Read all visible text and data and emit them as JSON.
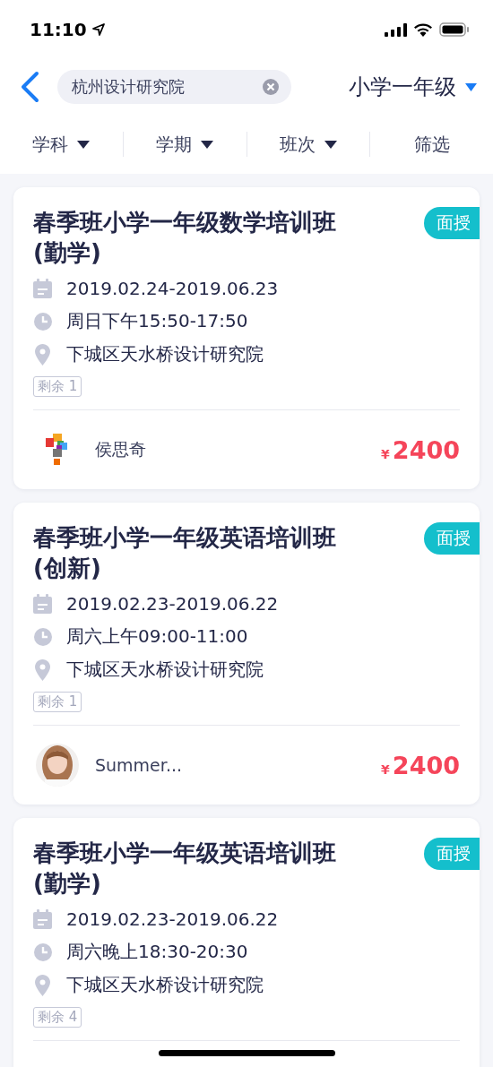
{
  "status_bar": {
    "time": "11:10"
  },
  "search": {
    "value": "杭州设计研究院"
  },
  "grade": {
    "label": "小学一年级"
  },
  "filters": [
    {
      "label": "学科",
      "dropdown": true
    },
    {
      "label": "学期",
      "dropdown": true
    },
    {
      "label": "班次",
      "dropdown": true
    },
    {
      "label": "筛选",
      "dropdown": false
    }
  ],
  "courses": [
    {
      "title": "春季班小学一年级数学培训班(勤学)",
      "mode": "面授",
      "dates": "2019.02.24-2019.06.23",
      "time": "周日下午15:50-17:50",
      "location": "下城区天水桥设计研究院",
      "remaining": "剩余 1",
      "teacher": {
        "name": "侯思奇",
        "kind": "logo"
      },
      "currency": "¥",
      "price": "2400"
    },
    {
      "title": "春季班小学一年级英语培训班(创新)",
      "mode": "面授",
      "dates": "2019.02.23-2019.06.22",
      "time": "周六上午09:00-11:00",
      "location": "下城区天水桥设计研究院",
      "remaining": "剩余 1",
      "teacher": {
        "name": "Summer..."
      },
      "currency": "¥",
      "price": "2400"
    },
    {
      "title": "春季班小学一年级英语培训班(勤学)",
      "mode": "面授",
      "dates": "2019.02.23-2019.06.22",
      "time": "周六晚上18:30-20:30",
      "location": "下城区天水桥设计研究院",
      "remaining": "剩余 4"
    }
  ]
}
